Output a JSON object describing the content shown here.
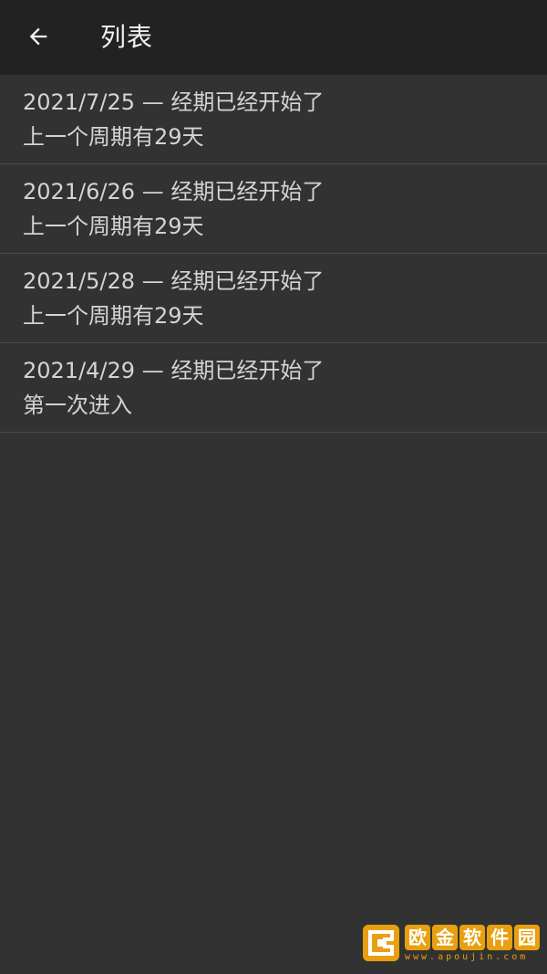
{
  "toolbar": {
    "back_icon": "arrow-left-icon",
    "title": "列表"
  },
  "list": {
    "items": [
      {
        "title": "2021/7/25 — 经期已经开始了",
        "subtitle": "上一个周期有29天"
      },
      {
        "title": "2021/6/26 — 经期已经开始了",
        "subtitle": "上一个周期有29天"
      },
      {
        "title": "2021/5/28 — 经期已经开始了",
        "subtitle": "上一个周期有29天"
      },
      {
        "title": "2021/4/29 — 经期已经开始了",
        "subtitle": "第一次进入"
      }
    ]
  },
  "watermark": {
    "chars": [
      "欧",
      "金",
      "软",
      "件",
      "园"
    ],
    "url": "www.apoujin.com"
  },
  "colors": {
    "background": "#323232",
    "toolbar": "#222222",
    "text": "#d4d4d4",
    "divider": "#4a4a4a",
    "watermark": "#e8a010"
  }
}
